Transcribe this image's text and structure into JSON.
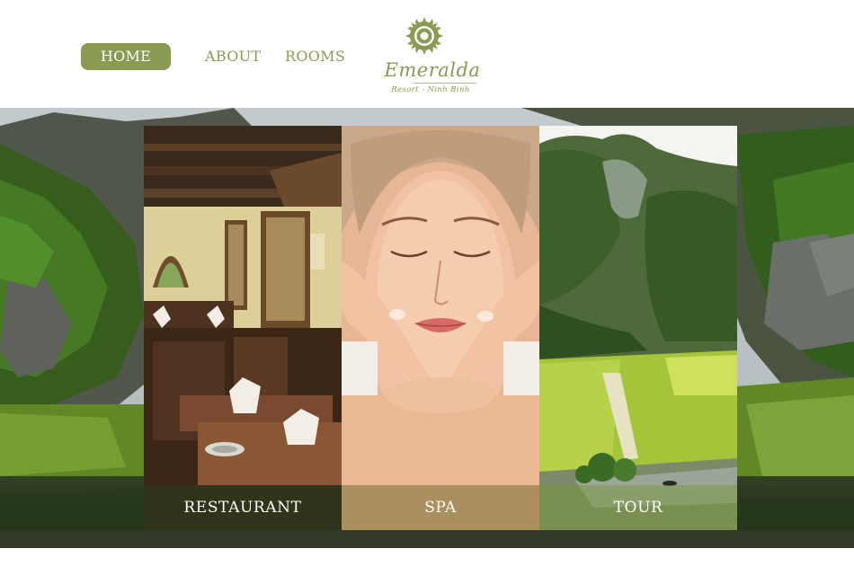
{
  "colors": {
    "brand": "#8a9a52",
    "nav_active_bg": "#8a9a52",
    "background": "#ffffff"
  },
  "nav": {
    "items": [
      {
        "label": "HOME",
        "active": true
      },
      {
        "label": "ABOUT",
        "active": false
      },
      {
        "label": "ROOMS",
        "active": false
      }
    ]
  },
  "logo": {
    "icon": "sun-flower-emblem-icon",
    "name": "Emeralda",
    "subtitle": "Resort - Ninh Binh"
  },
  "hero": {
    "background": "karst-mountain-river-landscape",
    "cards": [
      {
        "label": "RESTAURANT",
        "image": "restaurant-dining-room-photo"
      },
      {
        "label": "SPA",
        "image": "facial-massage-photo"
      },
      {
        "label": "TOUR",
        "image": "rice-field-river-photo"
      }
    ]
  }
}
